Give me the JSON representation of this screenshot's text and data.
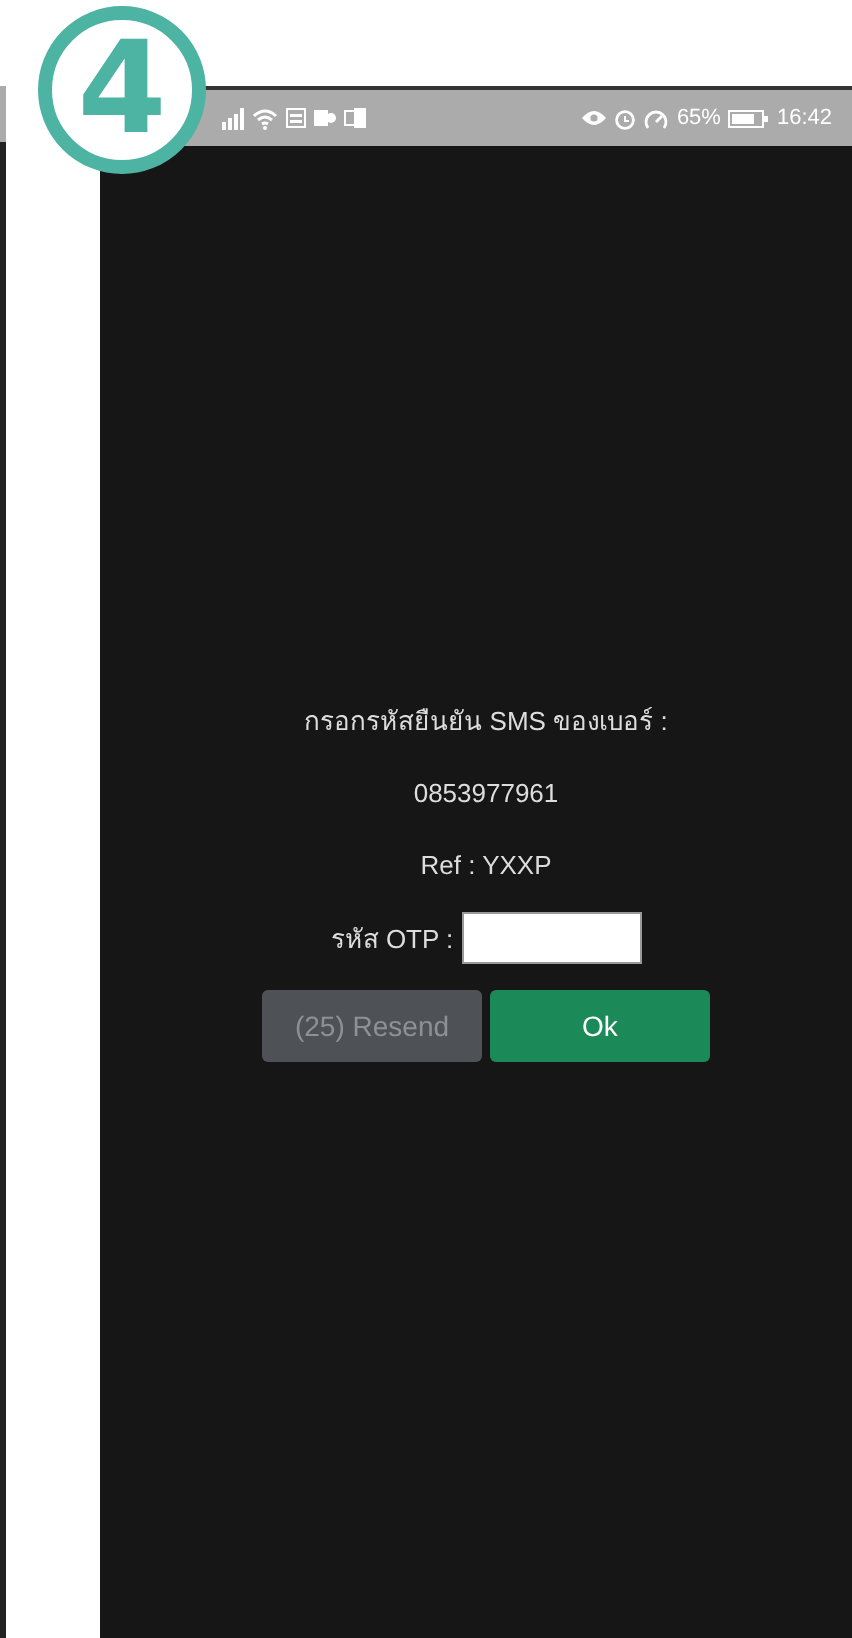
{
  "step_badge": "4",
  "status_bar": {
    "battery": "65%",
    "time": "16:42"
  },
  "otp_dialog": {
    "prompt": "กรอกรหัสยืนยัน SMS ของเบอร์ :",
    "phone_number": "0853977961",
    "reference": "Ref : YXXP",
    "otp_label": "รหัส OTP :",
    "buttons": [
      {
        "label": "(25) Resend",
        "kind": "secondary",
        "disabled": true
      },
      {
        "label": "Ok",
        "kind": "primary",
        "disabled": false
      }
    ]
  }
}
